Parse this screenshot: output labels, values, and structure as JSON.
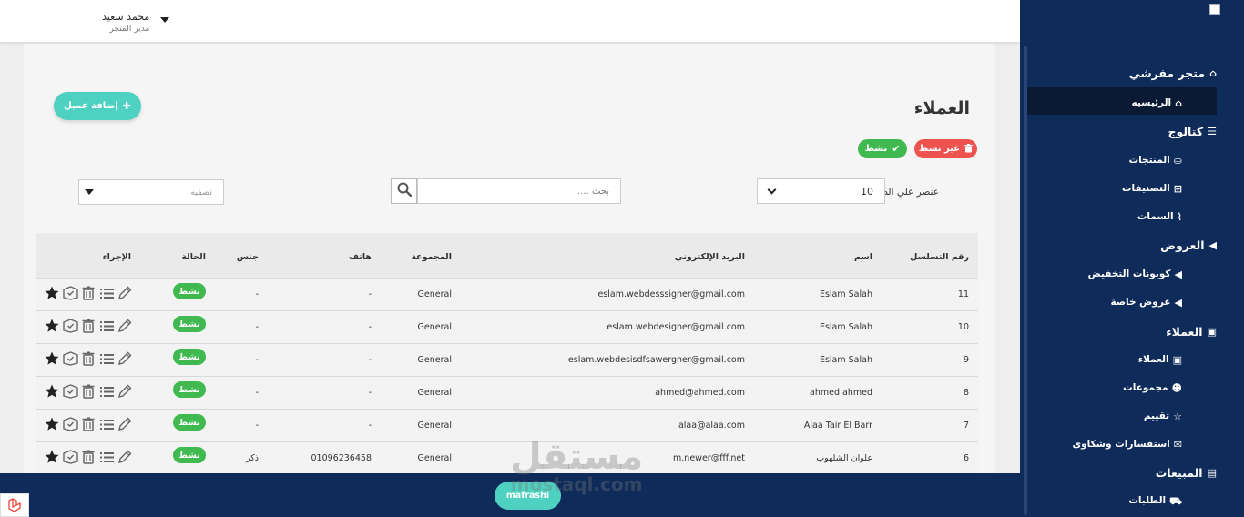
{
  "header": {
    "user_name": "محمد سعيد",
    "user_role": "مدير المتجر"
  },
  "sidebar": {
    "sections": [
      {
        "label": "متجر مفرشي",
        "icon": "home-icon"
      },
      {
        "label": "كتالوج",
        "icon": "database-icon"
      },
      {
        "label": "العروض",
        "icon": "megaphone-icon"
      },
      {
        "label": "العملاء",
        "icon": "contact-card-icon"
      },
      {
        "label": "المبيعات",
        "icon": "money-icon"
      }
    ],
    "items": [
      {
        "label": "الرئيسيه",
        "icon": "home-icon",
        "active": true
      },
      {
        "label": "المنتجات",
        "icon": "basket-icon"
      },
      {
        "label": "التصنيفات",
        "icon": "sitemap-icon"
      },
      {
        "label": "السمات",
        "icon": "paperclip-icon"
      },
      {
        "label": "كوبونات التخفيض",
        "icon": "megaphone-icon"
      },
      {
        "label": "عروض خاصة",
        "icon": "megaphone-icon"
      },
      {
        "label": "العملاء",
        "icon": "contact-card-icon"
      },
      {
        "label": "مجموعات",
        "icon": "users-icon"
      },
      {
        "label": "تقييم",
        "icon": "star-icon"
      },
      {
        "label": "استفسارات وشكاوى",
        "icon": "comments-icon"
      },
      {
        "label": "الطلبات",
        "icon": "cart-icon"
      }
    ]
  },
  "page": {
    "title": "العملاء",
    "add_button": "إضافة عميل",
    "inactive_button": "غير نشط",
    "active_button": "نشط",
    "per_page_label": "عنصر علي الصفحه",
    "per_page_value": "10",
    "search_placeholder": "بحث ....",
    "filter_placeholder": "تصفيه"
  },
  "table": {
    "headers": {
      "serial": "رقم التسلسل",
      "name": "اسم",
      "email": "البريد الإلكتروني",
      "group": "المجموعة",
      "phone": "هاتف",
      "gender": "جنس",
      "status": "الحالة",
      "action": "الإجراء"
    },
    "rows": [
      {
        "serial": "11",
        "name": "Eslam Salah",
        "email": "eslam.webdesssigner@gmail.com",
        "group": "General",
        "phone": "-",
        "gender": "-",
        "status": "نشط"
      },
      {
        "serial": "10",
        "name": "Eslam Salah",
        "email": "eslam.webdesigner@gmail.com",
        "group": "General",
        "phone": "-",
        "gender": "-",
        "status": "نشط"
      },
      {
        "serial": "9",
        "name": "Eslam Salah",
        "email": "eslam.webdesisdfsawergner@gmail.com",
        "group": "General",
        "phone": "-",
        "gender": "-",
        "status": "نشط"
      },
      {
        "serial": "8",
        "name": "ahmed ahmed",
        "email": "ahmed@ahmed.com",
        "group": "General",
        "phone": "-",
        "gender": "-",
        "status": "نشط"
      },
      {
        "serial": "7",
        "name": "Alaa Tair El Barr",
        "email": "alaa@alaa.com",
        "group": "General",
        "phone": "-",
        "gender": "-",
        "status": "نشط"
      },
      {
        "serial": "6",
        "name": "علوان الشلهوب",
        "email": "m.newer@fff.net",
        "group": "General",
        "phone": "01096236458",
        "gender": "ذكر",
        "status": "نشط"
      }
    ]
  },
  "footer": {
    "brand": "mafrashi"
  },
  "watermark": {
    "ar": "مستقل",
    "en": "mostaql.com"
  },
  "colors": {
    "sidebar": "#0f2b5a",
    "accent": "#4fd1c1",
    "success": "#3fb950",
    "danger": "#ef5350"
  }
}
